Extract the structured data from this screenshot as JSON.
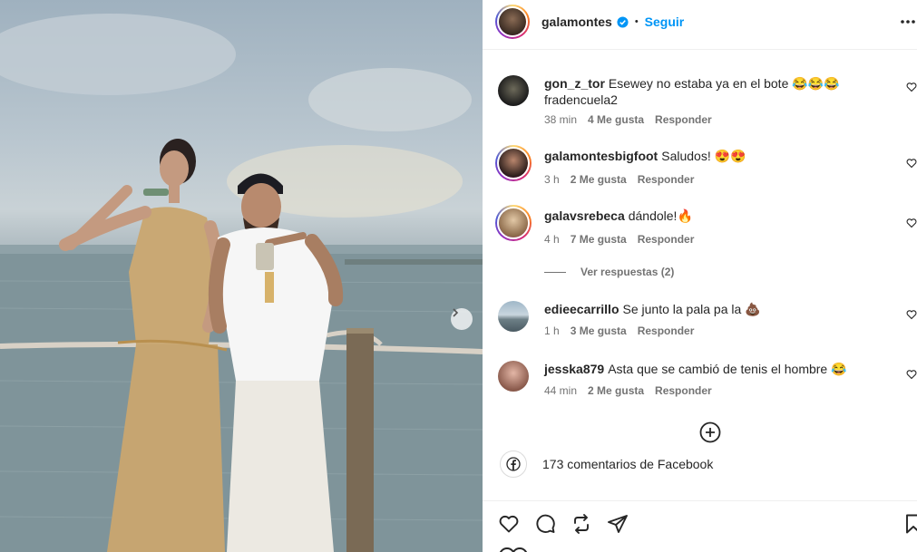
{
  "post": {
    "username": "galamontes",
    "follow_label": "Seguir",
    "separator": "•",
    "photo_alt": "Foto de galamontes en un muelle junto al mar"
  },
  "comments": [
    {
      "user": "gon_z_tor",
      "text": "Esewey no estaba ya en el bote 😂😂😂 fradencuela2",
      "time": "38 min",
      "likes": "4 Me gusta",
      "reply": "Responder"
    },
    {
      "user": "galamontesbigfoot",
      "text": "Saludos! 😍😍",
      "time": "3 h",
      "likes": "2 Me gusta",
      "reply": "Responder"
    },
    {
      "user": "galavsrebeca",
      "text": "dándole!🔥",
      "time": "4 h",
      "likes": "7 Me gusta",
      "reply": "Responder"
    },
    {
      "user": "edieecarrillo",
      "text": "Se junto la pala pa la 💩",
      "time": "1 h",
      "likes": "3 Me gusta",
      "reply": "Responder"
    },
    {
      "user": "jesska879",
      "text": "Asta que se cambió de tenis el hombre 😂",
      "time": "44 min",
      "likes": "2 Me gusta",
      "reply": "Responder"
    }
  ],
  "view_replies": "Ver respuestas (2)",
  "facebook_comments": "173 comentarios de Facebook",
  "icons": {
    "verified": "verified-badge-icon",
    "more": "more-options-icon",
    "next": "chevron-right-icon",
    "load_more": "plus-circle-icon",
    "facebook": "facebook-icon",
    "like": "heart-icon",
    "comment": "comment-icon",
    "repost": "repost-icon",
    "share": "share-icon",
    "save": "bookmark-icon"
  },
  "colors": {
    "accent": "#0095f6",
    "text": "#262626",
    "muted": "#737373",
    "divider": "#efefef"
  }
}
